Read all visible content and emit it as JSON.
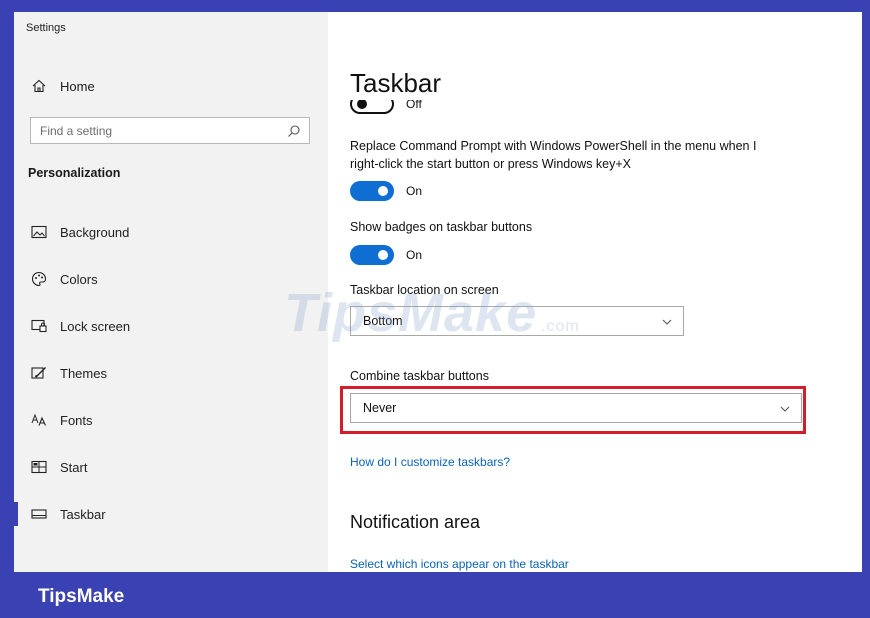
{
  "window": {
    "title": "Settings"
  },
  "sidebar": {
    "home_label": "Home",
    "search_placeholder": "Find a setting",
    "section_title": "Personalization",
    "items": [
      {
        "label": "Background",
        "icon": "image-icon"
      },
      {
        "label": "Colors",
        "icon": "palette-icon"
      },
      {
        "label": "Lock screen",
        "icon": "lock-screen-icon"
      },
      {
        "label": "Themes",
        "icon": "themes-icon"
      },
      {
        "label": "Fonts",
        "icon": "fonts-icon"
      },
      {
        "label": "Start",
        "icon": "start-icon"
      },
      {
        "label": "Taskbar",
        "icon": "taskbar-icon",
        "active": true
      }
    ]
  },
  "main": {
    "title": "Taskbar",
    "partial_toggle_label": "Off",
    "powershell": {
      "label": "Replace Command Prompt with Windows PowerShell in the menu when I right-click the start button or press Windows key+X",
      "state": "On"
    },
    "badges": {
      "label": "Show badges on taskbar buttons",
      "state": "On"
    },
    "location": {
      "label": "Taskbar location on screen",
      "value": "Bottom"
    },
    "combine": {
      "label": "Combine taskbar buttons",
      "value": "Never"
    },
    "customize_link": "How do I customize taskbars?",
    "notification_heading": "Notification area",
    "select_icons_link": "Select which icons appear on the taskbar"
  },
  "watermark": {
    "text": "TipsMake",
    "suffix": ".com"
  },
  "footer": {
    "brand": "TipsMake"
  },
  "colors": {
    "frame": "#3a41b3",
    "toggle_on": "#0e6ed1",
    "highlight": "#d21e2b",
    "link": "#0b63b6"
  }
}
